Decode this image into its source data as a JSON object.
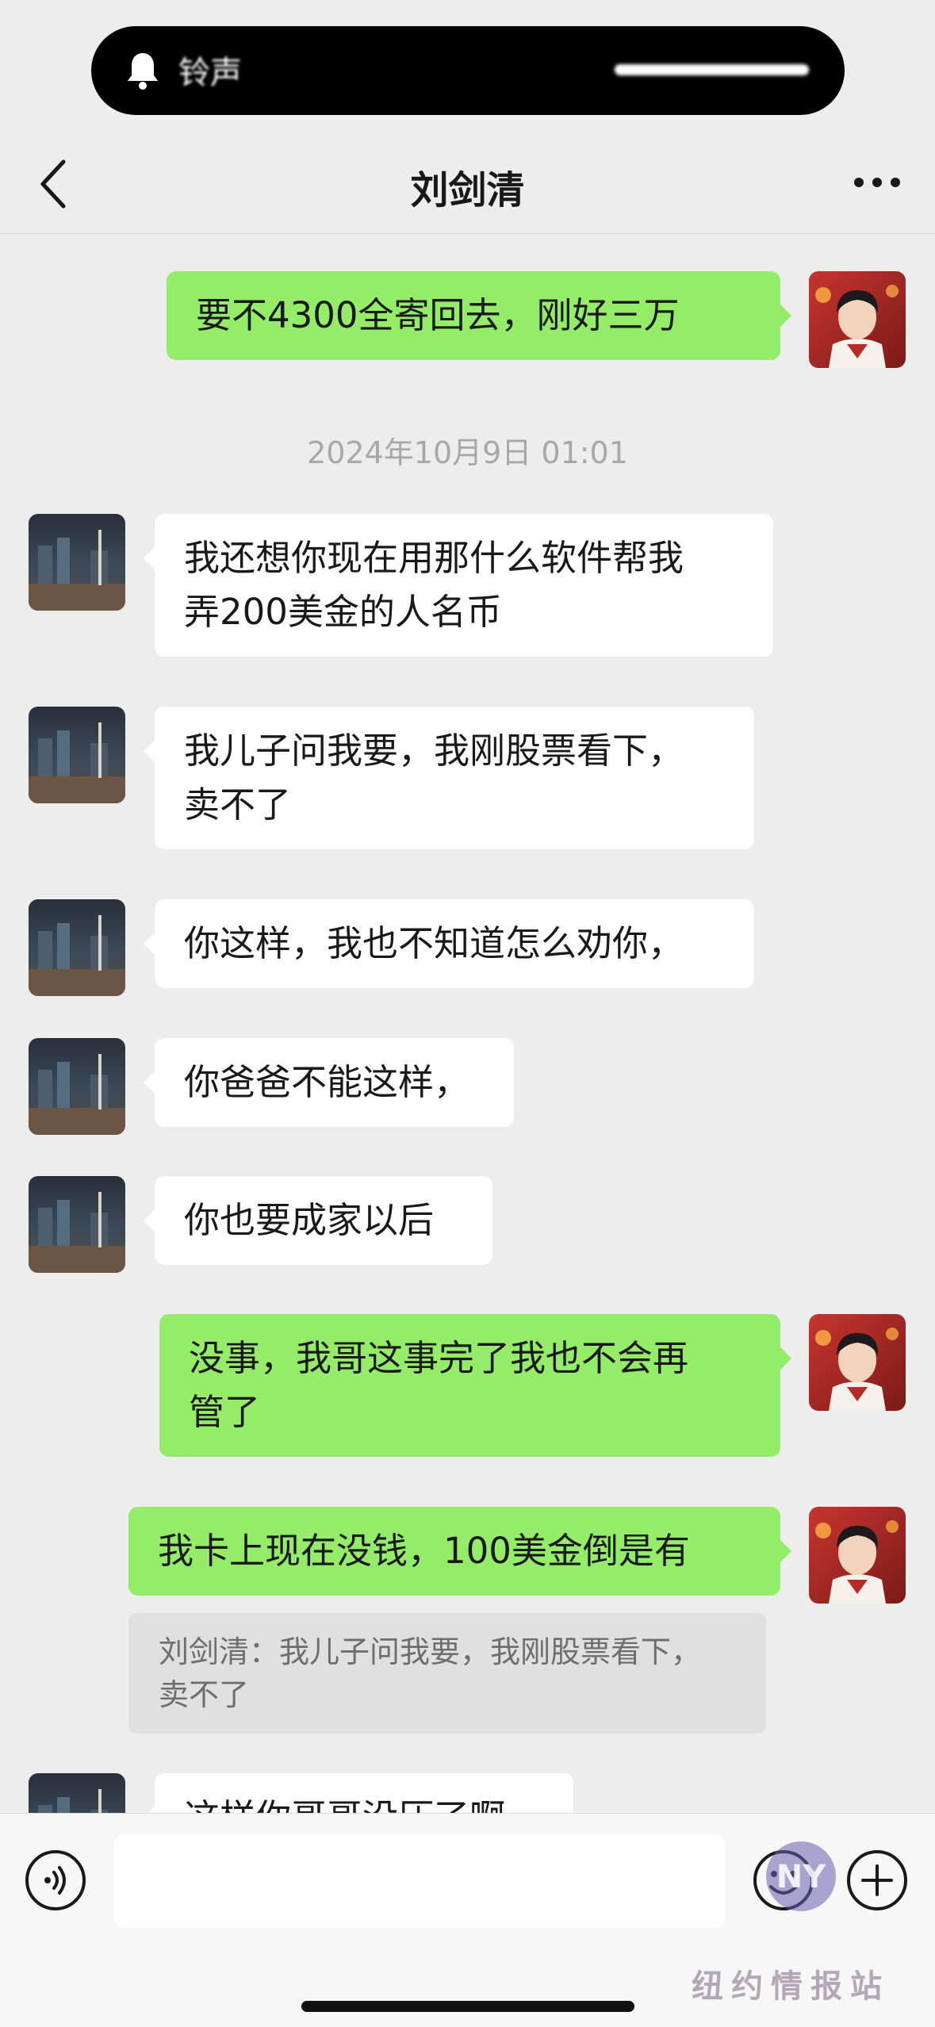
{
  "status": {
    "notification_text": "铃声"
  },
  "header": {
    "title": "刘剑清"
  },
  "messages": [
    {
      "text": "要不4300全寄回去，刚好三万"
    },
    {
      "text": "我还想你现在用那什么软件帮我\n弄200美金的人名币"
    },
    {
      "text": "我儿子问我要，我刚股票看下，\n卖不了"
    },
    {
      "text": "你这样，我也不知道怎么劝你，"
    },
    {
      "text": "你爸爸不能这样，"
    },
    {
      "text": "你也要成家以后"
    },
    {
      "text": "没事，我哥这事完了我也不会再\n管了"
    },
    {
      "text": "我卡上现在没钱，100美金倒是有"
    },
    {
      "text": "这样你哥哥没压了啊"
    }
  ],
  "timestamp": "2024年10月9日 01:01",
  "quote": {
    "text": "刘剑清：我儿子问我要，我刚股票看下，\n卖不了"
  },
  "input": {
    "placeholder": ""
  },
  "watermark": {
    "text": "纽约情报站",
    "logo_letters": "NY"
  },
  "colors": {
    "outgoing_bubble": "#95ec69",
    "incoming_bubble": "#ffffff",
    "background": "#ededed"
  },
  "icons": [
    "bell-icon",
    "back-chevron-icon",
    "more-dots-icon",
    "voice-icon",
    "emoji-icon",
    "plus-icon"
  ]
}
